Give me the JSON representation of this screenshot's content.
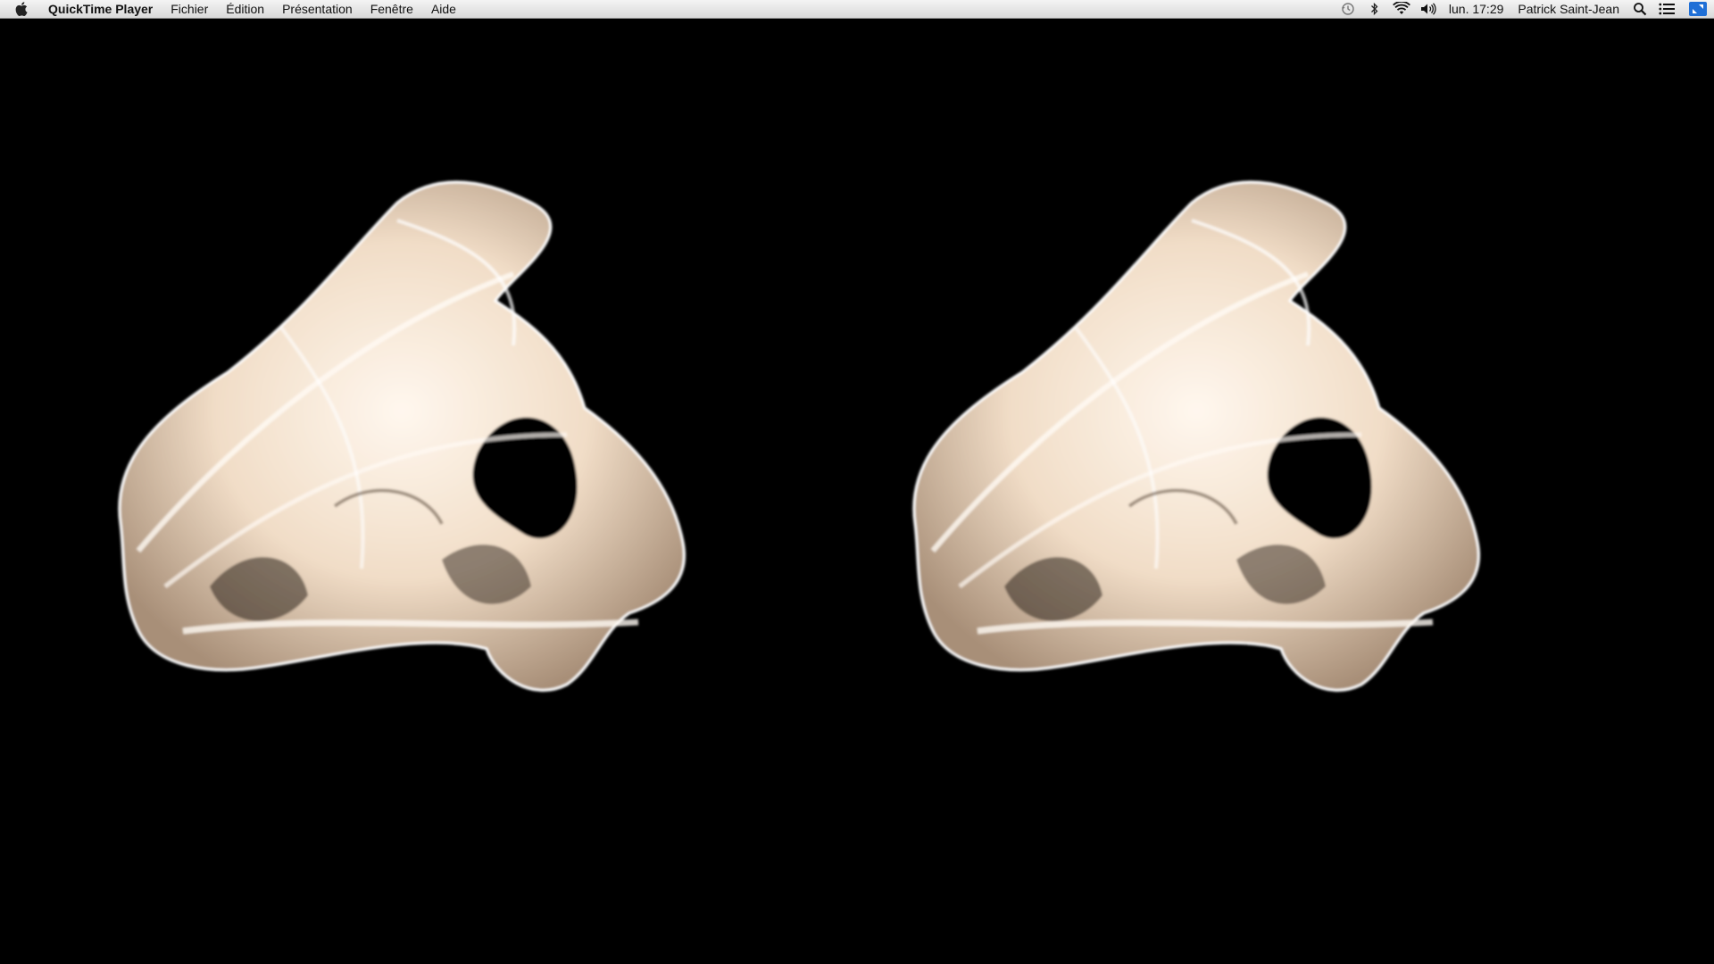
{
  "menubar": {
    "app_name": "QuickTime Player",
    "menus": [
      "Fichier",
      "Édition",
      "Présentation",
      "Fenêtre",
      "Aide"
    ],
    "clock": "lun. 17:29",
    "user": "Patrick Saint-Jean",
    "status_icons": [
      "time-machine-icon",
      "bluetooth-icon",
      "wifi-icon",
      "volume-icon",
      "spotlight-icon",
      "notification-center-icon",
      "fullscreen-exit-icon"
    ]
  },
  "video": {
    "layout": "side-by-side stereoscopic",
    "background": "#000000",
    "shape_color": "#f3e2cf"
  }
}
